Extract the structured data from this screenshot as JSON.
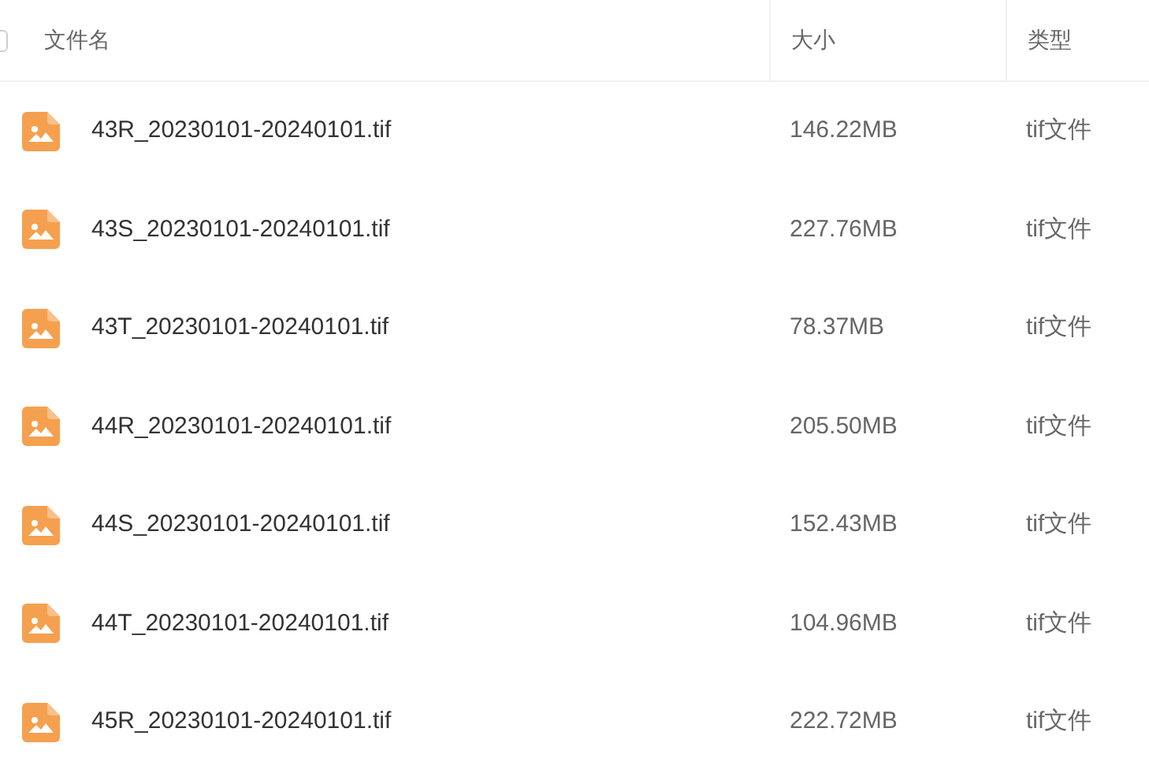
{
  "select_all": {
    "checked": false
  },
  "columns": [
    "文件名",
    "大小",
    "类型"
  ],
  "files": [
    {
      "name": "43R_20230101-20240101.tif",
      "size": "146.22MB",
      "type": "tif文件"
    },
    {
      "name": "43S_20230101-20240101.tif",
      "size": "227.76MB",
      "type": "tif文件"
    },
    {
      "name": "43T_20230101-20240101.tif",
      "size": "78.37MB",
      "type": "tif文件"
    },
    {
      "name": "44R_20230101-20240101.tif",
      "size": "205.50MB",
      "type": "tif文件"
    },
    {
      "name": "44S_20230101-20240101.tif",
      "size": "152.43MB",
      "type": "tif文件"
    },
    {
      "name": "44T_20230101-20240101.tif",
      "size": "104.96MB",
      "type": "tif文件"
    },
    {
      "name": "45R_20230101-20240101.tif",
      "size": "222.72MB",
      "type": "tif文件"
    }
  ]
}
